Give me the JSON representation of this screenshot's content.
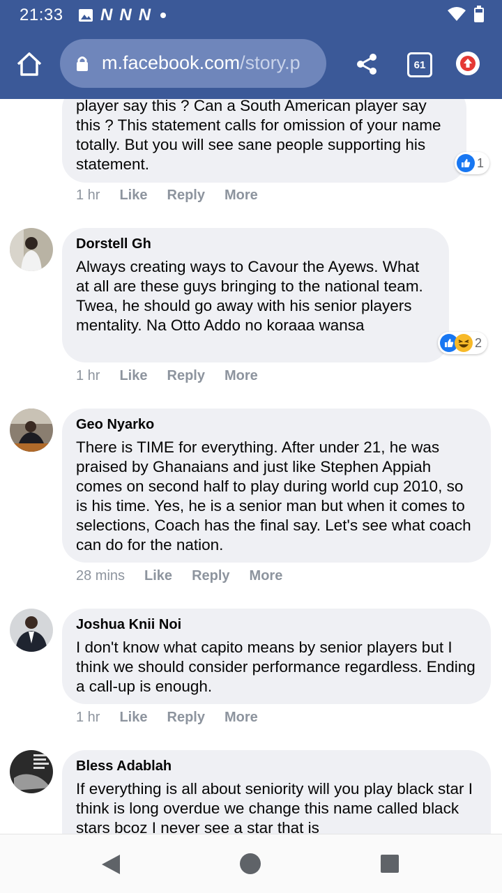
{
  "status_bar": {
    "time": "21:33",
    "notification_icons": [
      "image-icon",
      "n-icon",
      "n-icon",
      "n-icon"
    ],
    "signal_icons": [
      "wifi-icon",
      "battery-icon"
    ]
  },
  "browser": {
    "url_host": "m.facebook.com",
    "url_path": "/story.p",
    "tab_count": "61",
    "header_color": "#3b5998"
  },
  "comments": [
    {
      "author": "",
      "text": "player say this ? Can a South American player say this ? This statement calls for omission of your name totally. But you will see sane people supporting his statement.",
      "time": "1 hr",
      "reaction_count": "1",
      "reactions": [
        "like-icon"
      ]
    },
    {
      "author": "Dorstell Gh",
      "text": "Always creating ways to Cavour the Ayews. What at all are these guys bringing to the national team. Twea, he should go away with his senior players mentality. Na Otto Addo no koraaa wansa",
      "time": "1 hr",
      "reaction_count": "2",
      "reactions": [
        "like-icon",
        "haha-icon"
      ]
    },
    {
      "author": "Geo Nyarko",
      "text": "There is TIME for everything. After under 21, he was praised by Ghanaians and just like Stephen Appiah comes on second half to play during world cup 2010, so is his time. Yes, he is a senior man but when it comes to selections, Coach has the final say. Let's see what coach can do for the nation.",
      "time": "28 mins"
    },
    {
      "author": "Joshua Knii Noi",
      "text": "I don't know what capito means by senior players but I think we should consider performance regardless. Ending a call-up is enough.",
      "time": "1 hr"
    },
    {
      "author": "Bless Adablah",
      "text": "If everything is all about seniority will you play black star I think is long overdue we change this name called black stars bcoz I never see a star that is"
    }
  ],
  "actions": {
    "like": "Like",
    "reply": "Reply",
    "more": "More"
  },
  "colors": {
    "bubble": "#eff0f4",
    "like_blue": "#1877f2",
    "meta_gray": "#8d949e"
  }
}
